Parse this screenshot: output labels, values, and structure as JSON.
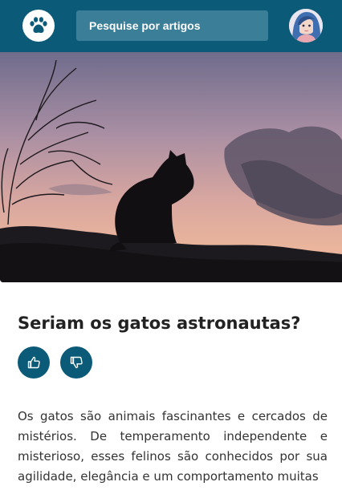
{
  "header": {
    "logo_icon": "paw-icon",
    "search_placeholder": "Pesquise por artigos",
    "avatar_icon": "user-avatar",
    "background_color": "#0b5a78"
  },
  "hero": {
    "image_description_icon": "cat-silhouette-sunset-image"
  },
  "article": {
    "title": "Seriam os gatos astronautas?",
    "like_icon": "thumbs-up-icon",
    "dislike_icon": "thumbs-down-icon",
    "body": "Os gatos são animais fascinantes e cercados de mistérios. De temperamento independente e misterioso, esses felinos são conhecidos por sua agilidade, elegância e um comportamento muitas"
  },
  "colors": {
    "accent": "#0b5a78",
    "search_bg": "#3a7e98",
    "title_text": "#222222",
    "body_text": "#333333"
  }
}
